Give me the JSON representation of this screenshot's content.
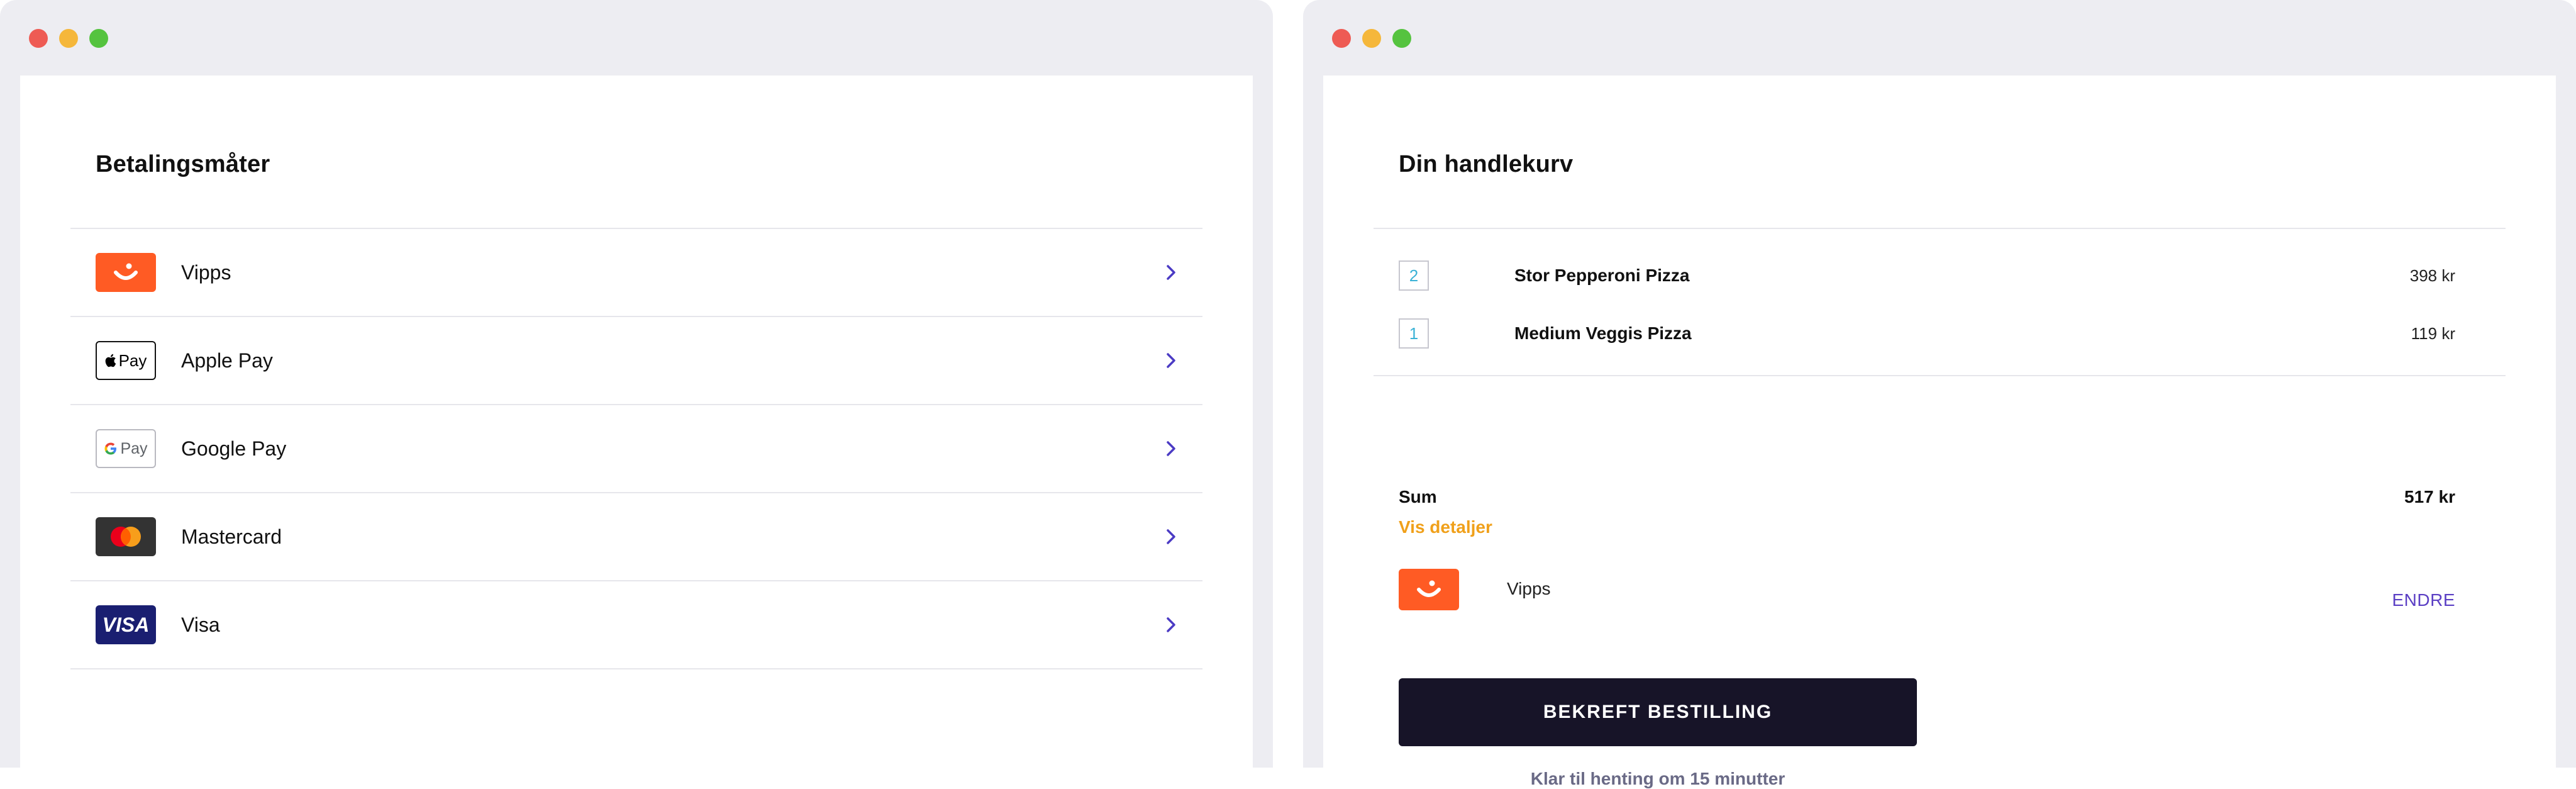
{
  "payment_window": {
    "title": "Betalingsmåter",
    "methods": [
      {
        "label": "Vipps",
        "icon": "vipps-logo-icon"
      },
      {
        "label": "Apple Pay",
        "icon": "apple-pay-logo-icon",
        "logo_text": "Pay"
      },
      {
        "label": "Google Pay",
        "icon": "google-pay-logo-icon",
        "logo_text": "Pay"
      },
      {
        "label": "Mastercard",
        "icon": "mastercard-logo-icon"
      },
      {
        "label": "Visa",
        "icon": "visa-logo-icon",
        "logo_text": "VISA"
      }
    ]
  },
  "cart_window": {
    "title": "Din handlekurv",
    "items": [
      {
        "qty": "2",
        "name": "Stor Pepperoni Pizza",
        "price": "398 kr"
      },
      {
        "qty": "1",
        "name": "Medium Veggis Pizza",
        "price": "119 kr"
      }
    ],
    "sum_label": "Sum",
    "sum_value": "517 kr",
    "details_link": "Vis detaljer",
    "selected_payment": "Vipps",
    "change_label": "ENDRE",
    "confirm_label": "BEKREFT BESTILLING",
    "pickup_note": "Klar til henting om 15 minutter"
  },
  "colors": {
    "vipps_orange": "#ff5b24",
    "accent_purple": "#5b3fc4",
    "link_orange": "#f0a01a",
    "button_dark": "#171428",
    "qty_blue": "#3bb2d6"
  }
}
